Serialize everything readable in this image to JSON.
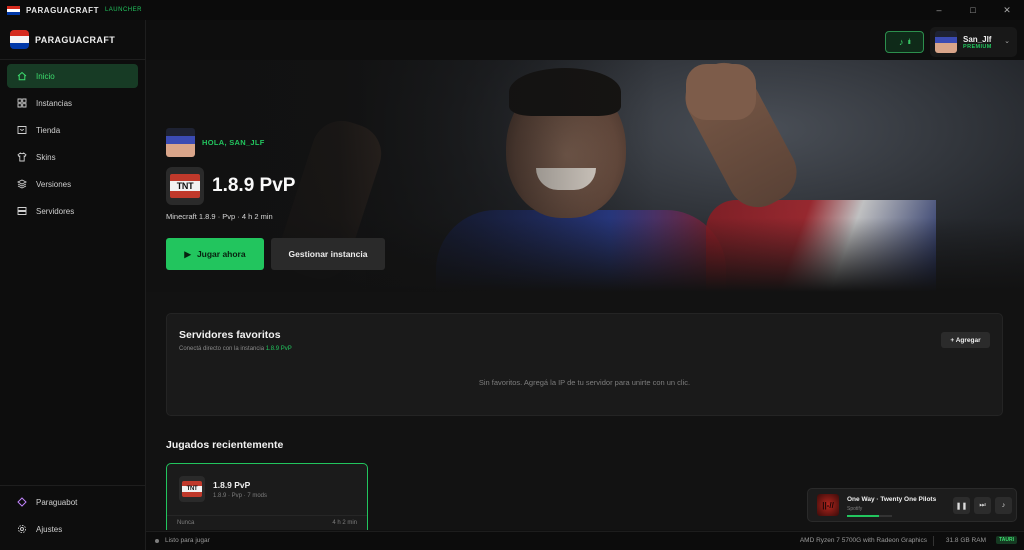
{
  "titlebar": {
    "app_name": "PARAGUACRAFT",
    "subtitle": "LAUNCHER",
    "minimize": "–",
    "maximize": "□",
    "close": "✕"
  },
  "brand": {
    "name": "PARAGUACRAFT"
  },
  "nav": [
    {
      "label": "Inicio",
      "icon": "home-icon",
      "active": true
    },
    {
      "label": "Instancias",
      "icon": "grid-icon"
    },
    {
      "label": "Tienda",
      "icon": "store-icon"
    },
    {
      "label": "Skins",
      "icon": "shirt-icon"
    },
    {
      "label": "Versiones",
      "icon": "layers-icon"
    },
    {
      "label": "Servidores",
      "icon": "server-icon"
    }
  ],
  "nav_bottom": [
    {
      "label": "Paraguabot",
      "icon": "bot-icon"
    },
    {
      "label": "Ajustes",
      "icon": "gear-icon"
    }
  ],
  "user": {
    "name": "San_Jlf",
    "plan": "PREMIUM"
  },
  "hero": {
    "greeting": "HOLA, SAN_JLF",
    "instance_name": "1.8.9 PvP",
    "tnt_label": "TNT",
    "meta": "Minecraft 1.8.9 · Pvp · 4 h 2 min",
    "play_label": "Jugar ahora",
    "manage_label": "Gestionar instancia"
  },
  "favorites": {
    "title": "Servidores favoritos",
    "subtitle_prefix": "Conectá directo con la instancia ",
    "subtitle_instance": "1.8.9 PvP",
    "add_label": "+ Agregar",
    "empty_text": "Sin favoritos. Agregá la IP de tu servidor para unirte con un clic."
  },
  "recent": {
    "title": "Jugados recientemente",
    "cards": [
      {
        "name": "1.8.9 PvP",
        "meta": "1.8.9 · Pvp · 7 mods",
        "last_played": "Nunca",
        "time": "4 h 2 min"
      }
    ]
  },
  "player": {
    "song": "One Way · Twenty One Pilots",
    "source": "Spotify",
    "progress": 0.7
  },
  "status": {
    "ready": "Listo para jugar",
    "cpu": "AMD Ryzen 7 5700G with Radeon Graphics",
    "ram": "31.8 GB RAM",
    "tag": "TAURI"
  },
  "colors": {
    "accent": "#22c55e",
    "background": "#101010",
    "card": "#1a1a1a"
  }
}
